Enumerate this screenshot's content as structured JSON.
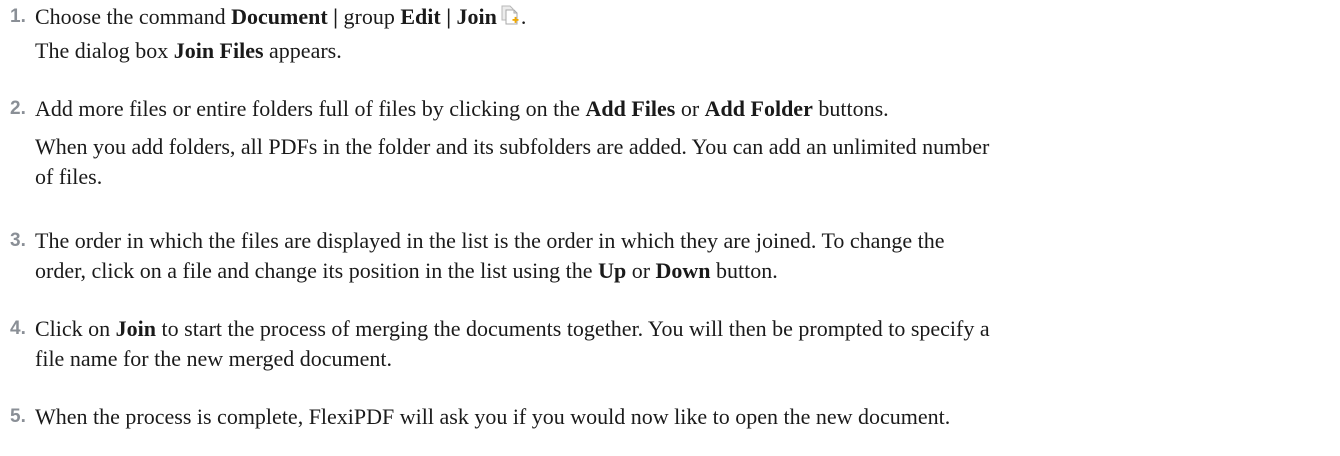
{
  "steps": [
    {
      "number": "1.",
      "main": {
        "t1": "Choose the command ",
        "b1": "Document |",
        "t2": " group ",
        "b2": "Edit | Join",
        "t3": "."
      },
      "sub": {
        "t1": "The dialog box ",
        "b1": "Join Files",
        "t2": " appears."
      },
      "icon": "join-document-icon"
    },
    {
      "number": "2.",
      "main": {
        "t1": "Add more files or entire folders full of files by clicking on the ",
        "b1": "Add Files",
        "t2": " or ",
        "b2": "Add Folder",
        "t3": " buttons."
      },
      "sub": {
        "line1": "When you add folders, all PDFs in the folder and its subfolders are added. You can add an unlimited number",
        "line2": "of files."
      }
    },
    {
      "number": "3.",
      "main": {
        "line1": "The order in which the files are displayed in the list is the order in which they are joined. To change the",
        "t1": "order, click on a file and change its position in the list using the ",
        "b1": "Up",
        "t2": " or ",
        "b2": "Down",
        "t3": " button."
      }
    },
    {
      "number": "4.",
      "main": {
        "t1": "Click on ",
        "b1": "Join",
        "t2": " to start the process of merging the documents together. You will then be prompted to specify a",
        "line2": "file name for the new merged document."
      }
    },
    {
      "number": "5.",
      "main": {
        "line1": "When the process is complete, FlexiPDF will ask you if you would now like to open the new document."
      }
    }
  ]
}
